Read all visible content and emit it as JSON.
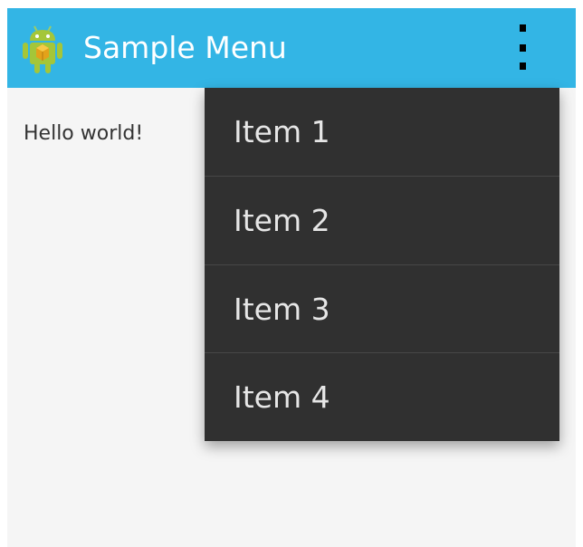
{
  "action_bar": {
    "title": "Sample Menu",
    "background_color": "#33b5e5",
    "app_icon": "android-robot-icon",
    "overflow_icon": "overflow-menu-icon"
  },
  "content": {
    "text": "Hello world!"
  },
  "menu": {
    "background_color": "#303030",
    "items": [
      {
        "label": "Item 1"
      },
      {
        "label": "Item 2"
      },
      {
        "label": "Item 3"
      },
      {
        "label": "Item 4"
      }
    ]
  }
}
